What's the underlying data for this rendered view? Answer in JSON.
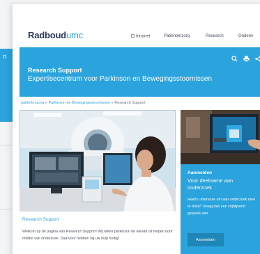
{
  "background": {
    "panel_letter": "n",
    "link_text": "patiëntenzorg"
  },
  "logo": {
    "brand": "Radboud",
    "suffix": "umc"
  },
  "nav": {
    "intranet": "Intranet",
    "patients": "Patiëntenzorg",
    "research": "Research",
    "education": "Onderw"
  },
  "banner": {
    "title": "Research Support",
    "subtitle": "Expertisecentrum voor Parkinson en Bewegingsstoornissen",
    "tools": [
      "search-icon",
      "print-icon",
      "share-icon"
    ]
  },
  "breadcrumb": {
    "item1": "patiëntenzorg",
    "sep": "»",
    "item2": "Parkinson en Bewegingsstoornissen",
    "current": "Research Support"
  },
  "article": {
    "title": "Research Support",
    "text": "Welkom op de pagina van Research Support! Wij willen parkinson de wereld uit helpen door middel van onderzoek. Daarvoor hebben wij uw hulp nodig!"
  },
  "sidebar": {
    "title": "Aanmelden",
    "subtitle": "Voor deelname aan onderzoek",
    "text": "Heeft u interesse om aan onderzoek mee te doen? Vraag dan een vrijblijvend gesprek aan.",
    "button": "Aanmelden"
  },
  "colors": {
    "brand_blue": "#2ba3dc",
    "navy": "#2b3a5a",
    "button_blue": "#1f86b8"
  }
}
